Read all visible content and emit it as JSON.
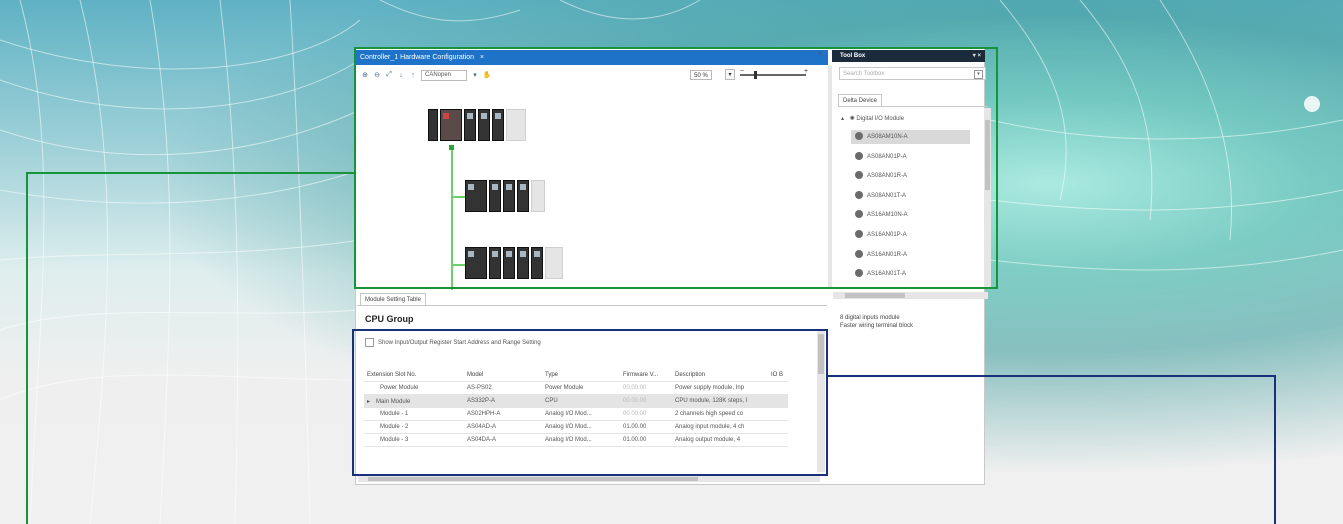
{
  "window": {
    "doc_tab_title": "Controller_1 Hardware Configuration",
    "doc_tab_close": "×",
    "doc_pane_close": "×"
  },
  "toolbar": {
    "buttons": [
      "zoom-in",
      "zoom-out",
      "fit",
      "down",
      "up"
    ],
    "combo_value": "CANopen",
    "zoom_value": "50 %",
    "zoom_min": "−",
    "zoom_max": "+"
  },
  "toolbox": {
    "title": "Tool Box",
    "pin": "▾",
    "close": "×",
    "search_placeholder": "Search Toolbox",
    "tab_label": "Delta Device",
    "category": "Digital I/O Module",
    "items": [
      "AS08AM10N-A",
      "AS08AN01P-A",
      "AS08AN01R-A",
      "AS08AN01T-A",
      "AS16AM10N-A",
      "AS16AN01P-A",
      "AS16AN01R-A",
      "AS16AN01T-A"
    ],
    "selected_index": 0,
    "description_line1": "8 digital inputs module",
    "description_line2": "Faster wiring terminal block"
  },
  "module_setting": {
    "tab_label": "Module Setting Table",
    "group_title": "CPU Group",
    "checkbox_label": "Show Input/Output Register Start Address and Range Setting",
    "columns": [
      "Extension Slot No.",
      "Model",
      "Type",
      "Firmware V...",
      "Description",
      "IO B"
    ],
    "rows": [
      {
        "slot": "Power Module",
        "model": "AS-PS02",
        "type": "Power Module",
        "fw": "00.00.00",
        "desc": "Power supply module, Inp"
      },
      {
        "slot": "Main Module",
        "model": "AS332P-A",
        "type": "CPU",
        "fw": "00.00.00",
        "desc": "CPU module, 128K steps, I"
      },
      {
        "slot": "Module - 1",
        "model": "AS02HPH-A",
        "type": "Analog I/O Mod...",
        "fw": "00.00.00",
        "desc": "2 channels high speed co"
      },
      {
        "slot": "Module - 2",
        "model": "AS04AD-A",
        "type": "Analog I/O Mod...",
        "fw": "01.00.00",
        "desc": "Analog input module, 4 ch"
      },
      {
        "slot": "Module - 3",
        "model": "AS04DA-A",
        "type": "Analog I/O Mod...",
        "fw": "01.00.00",
        "desc": "Analog output module, 4"
      }
    ],
    "row_marker": "▸"
  },
  "colors": {
    "accent_blue": "#1e73c8",
    "frame_green": "#17943a",
    "frame_navy": "#19307a",
    "toolbox_header": "#1b2b3c"
  },
  "icons": {
    "toolbar_zoom_in": "zoom-in-icon",
    "toolbar_zoom_out": "zoom-out-icon",
    "tree_expand": "caret-down-icon",
    "device_item": "device-module-icon",
    "category": "gear-icon"
  }
}
